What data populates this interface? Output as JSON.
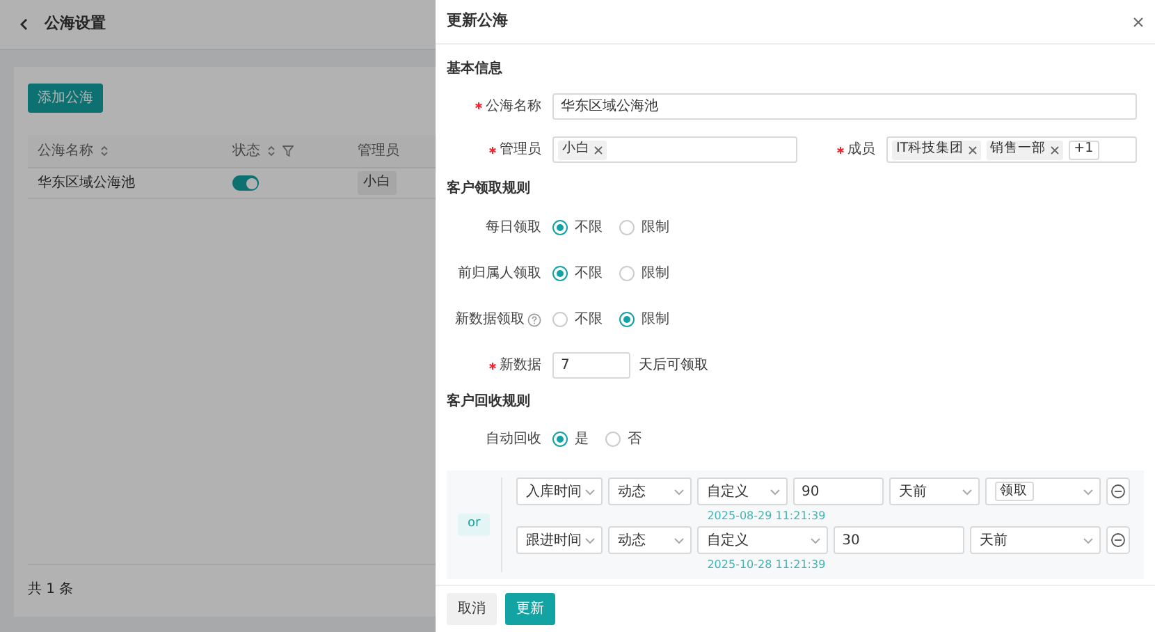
{
  "page": {
    "title": "公海设置",
    "add_button": "添加公海",
    "columns": [
      {
        "label": "公海名称",
        "sortable": true,
        "filter": false
      },
      {
        "label": "状态",
        "sortable": true,
        "filter": true
      },
      {
        "label": "管理员",
        "sortable": false,
        "filter": false
      }
    ],
    "rows": [
      {
        "name": "华东区域公海池",
        "enabled": true,
        "admin": "小白"
      }
    ],
    "total": "共 1 条"
  },
  "drawer": {
    "title": "更新公海",
    "basic": {
      "heading": "基本信息",
      "name": {
        "label": "公海名称",
        "required": true,
        "value": "华东区域公海池"
      },
      "admins": {
        "label": "管理员",
        "required": true,
        "tags": [
          "小白"
        ]
      },
      "members": {
        "label": "成员",
        "required": true,
        "tags": [
          "IT科技集团",
          "销售一部"
        ],
        "more": "+1"
      }
    },
    "claim": {
      "heading": "客户领取规则",
      "rules": [
        {
          "label": "每日领取",
          "help": false,
          "options": [
            {
              "label": "不限",
              "selected": true
            },
            {
              "label": "限制",
              "selected": false
            }
          ]
        },
        {
          "label": "前归属人领取",
          "help": false,
          "options": [
            {
              "label": "不限",
              "selected": true
            },
            {
              "label": "限制",
              "selected": false
            }
          ]
        },
        {
          "label": "新数据领取",
          "help": true,
          "options": [
            {
              "label": "不限",
              "selected": false
            },
            {
              "label": "限制",
              "selected": true
            }
          ]
        }
      ],
      "new_data": {
        "label": "新数据",
        "required": true,
        "value": "7",
        "suffix": "天后可领取"
      }
    },
    "recycle": {
      "heading": "客户回收规则",
      "auto": {
        "label": "自动回收",
        "options": [
          {
            "label": "是",
            "selected": true
          },
          {
            "label": "否",
            "selected": false
          }
        ]
      },
      "connector": "or",
      "conditions": [
        {
          "field": "入库时间",
          "mode": "动态",
          "period": "自定义",
          "value": "90",
          "unit": "天前",
          "action": "领取",
          "date": "2025-08-29 11:21:39"
        },
        {
          "field": "跟进时间",
          "mode": "动态",
          "period": "自定义",
          "value": "30",
          "unit": "天前",
          "date": "2025-10-28 11:21:39"
        }
      ]
    },
    "buttons": [
      {
        "label": "取消",
        "kind": "secondary"
      },
      {
        "label": "更新",
        "kind": "primary"
      }
    ]
  }
}
